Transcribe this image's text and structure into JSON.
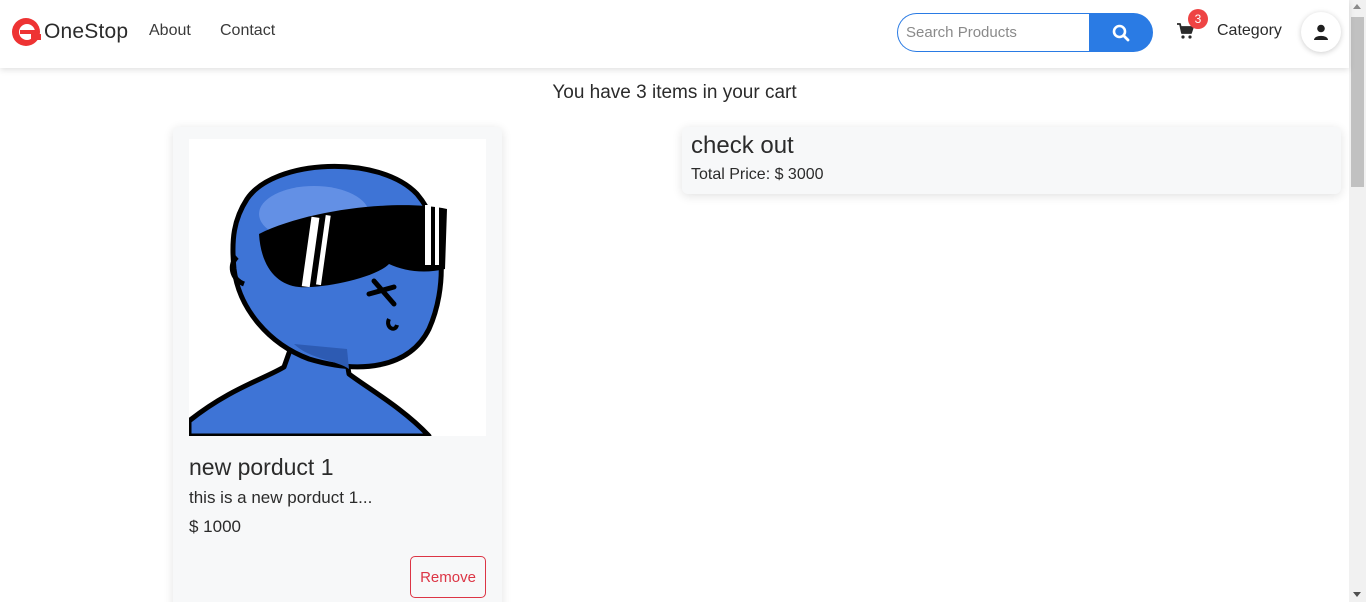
{
  "navbar": {
    "brand_name": "OneStop",
    "links": {
      "about": "About",
      "contact": "Contact"
    },
    "search": {
      "placeholder": "Search Products",
      "value": ""
    },
    "cart_count": "3",
    "category_label": "Category",
    "colors": {
      "accent": "#2a7be4",
      "brand": "#ee3333",
      "badge": "#ee4444"
    }
  },
  "main": {
    "cart_heading": "You have 3 items in your cart",
    "product": {
      "name": "new porduct 1",
      "description": "this is a new porduct 1...",
      "price": "$ 1000",
      "remove_label": "Remove"
    },
    "checkout": {
      "title": "check out",
      "total": "Total Price: $ 3000"
    }
  }
}
